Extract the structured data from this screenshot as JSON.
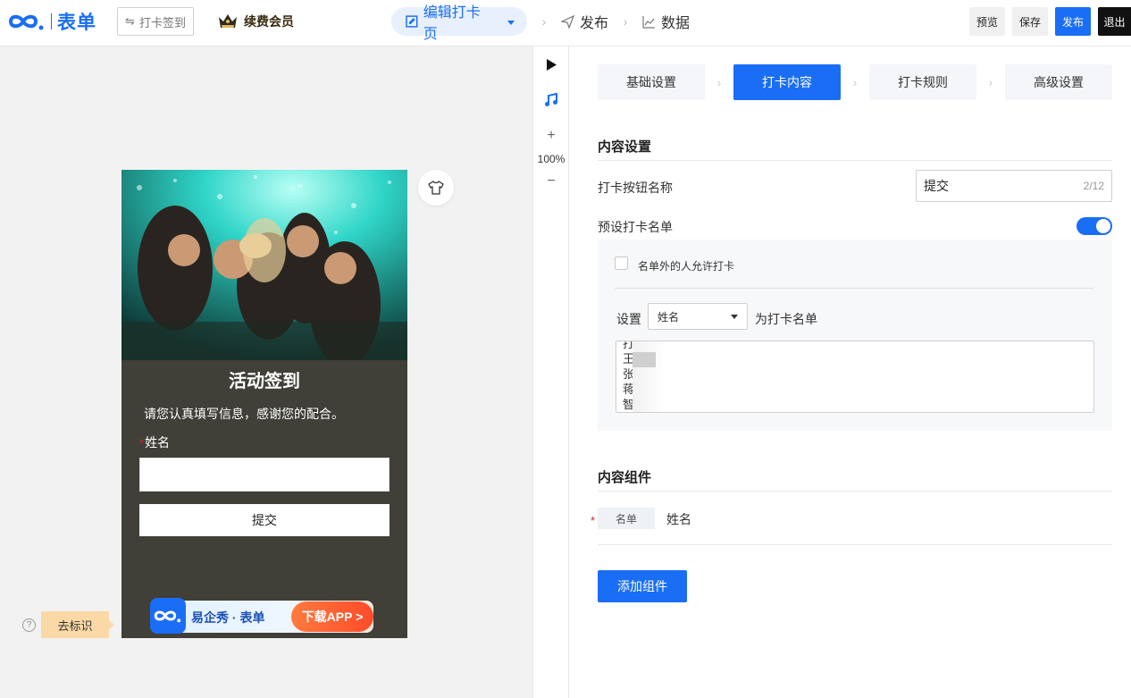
{
  "header": {
    "brand": "表单",
    "checkin_type": "打卡签到",
    "vip_label": "续费会员",
    "steps": [
      {
        "label": "编辑打卡页",
        "icon": "edit-icon"
      },
      {
        "label": "发布",
        "icon": "send-icon"
      },
      {
        "label": "数据",
        "icon": "chart-icon"
      }
    ],
    "buttons": {
      "preview": "预览",
      "save": "保存",
      "publish": "发布",
      "exit": "退出"
    },
    "accent": "#1a6ef5"
  },
  "preview": {
    "title": "活动签到",
    "description": "请您认真填写信息，感谢您的配合。",
    "field_label": "姓名",
    "required_mark": "*",
    "submit_label": "提交",
    "app_name": "易企秀 · 表单",
    "app_download": "下载APP >",
    "background": "#403f38"
  },
  "canvas": {
    "remove_mark": "去标识",
    "help_icon": "?"
  },
  "toolbar": {
    "zoom": "100%"
  },
  "panel": {
    "tabs": [
      "基础设置",
      "打卡内容",
      "打卡规则",
      "高级设置"
    ],
    "active_tab": 1,
    "content_settings": {
      "title": "内容设置",
      "button_name_label": "打卡按钮名称",
      "button_name_value": "提交",
      "button_name_count": "2/12",
      "preset_label": "预设打卡名单",
      "preset_enabled": true,
      "allow_outside_label": "名单外的人允许打卡",
      "allow_outside_checked": false,
      "set_label": "设置",
      "set_field": "姓名",
      "as_label": "为打卡名单",
      "names": [
        "打",
        "王",
        "张",
        "蒋",
        "智"
      ]
    },
    "components": {
      "title": "内容组件",
      "required_mark": "*",
      "items": [
        {
          "tag": "名单",
          "name": "姓名"
        }
      ],
      "add_label": "添加组件"
    }
  }
}
